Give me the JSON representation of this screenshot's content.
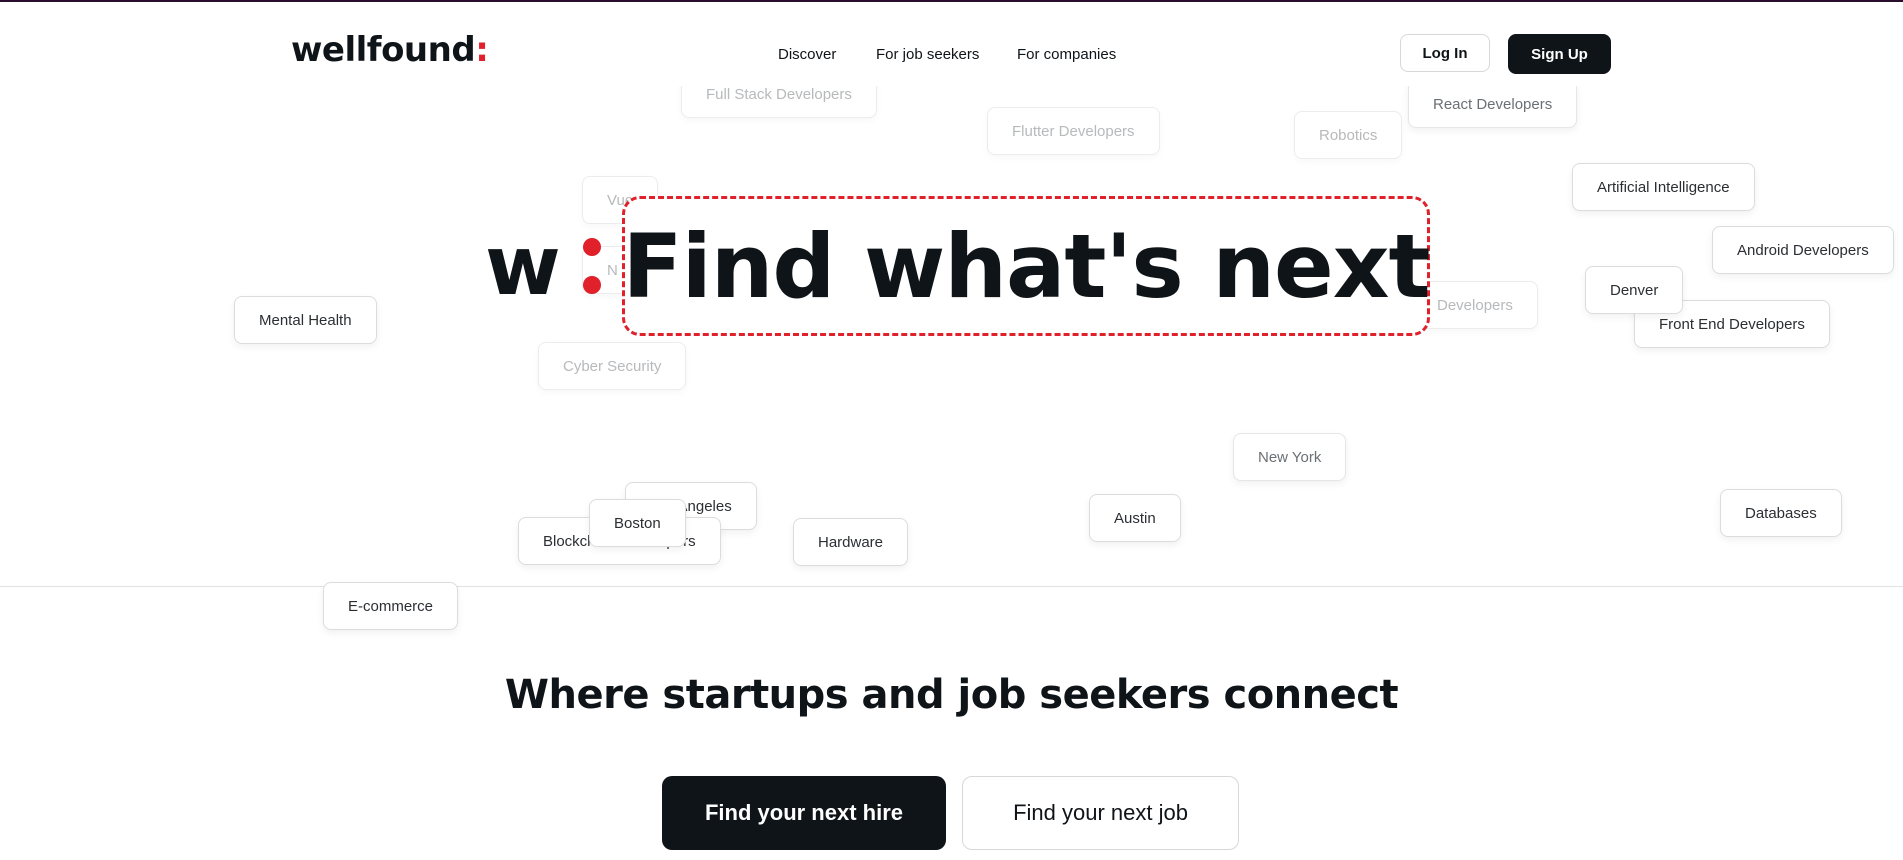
{
  "brand": {
    "name": "wellfound",
    "colon": ":"
  },
  "nav": {
    "discover": "Discover",
    "job_seekers": "For job seekers",
    "companies": "For companies"
  },
  "auth": {
    "login": "Log In",
    "signup": "Sign Up"
  },
  "hero": {
    "mark": "w",
    "title": "Find what's next",
    "tags": {
      "full_stack": "Full Stack Developers",
      "flutter": "Flutter Developers",
      "robotics": "Robotics",
      "react": "React Developers",
      "vue": "Vue",
      "artificial_intelligence": "Artificial Intelligence",
      "android": "Android Developers",
      "mental_health": "Mental Health",
      "n_item": "N",
      "developers": "Developers",
      "denver": "Denver",
      "front_end": "Front End Developers",
      "cyber_security": "Cyber Security",
      "new_york": "New York",
      "los_angeles": "Los Angeles",
      "boston": "Boston",
      "blockchain": "Blockchain Developers",
      "hardware": "Hardware",
      "austin": "Austin",
      "databases": "Databases",
      "ecommerce": "E-commerce"
    }
  },
  "section": {
    "subtitle": "Where startups and job seekers connect"
  },
  "cta": {
    "hire": "Find your next hire",
    "job": "Find your next job"
  },
  "colors": {
    "accent": "#e0202a",
    "dark": "#0f1418",
    "topline": "#2a0e2e"
  }
}
